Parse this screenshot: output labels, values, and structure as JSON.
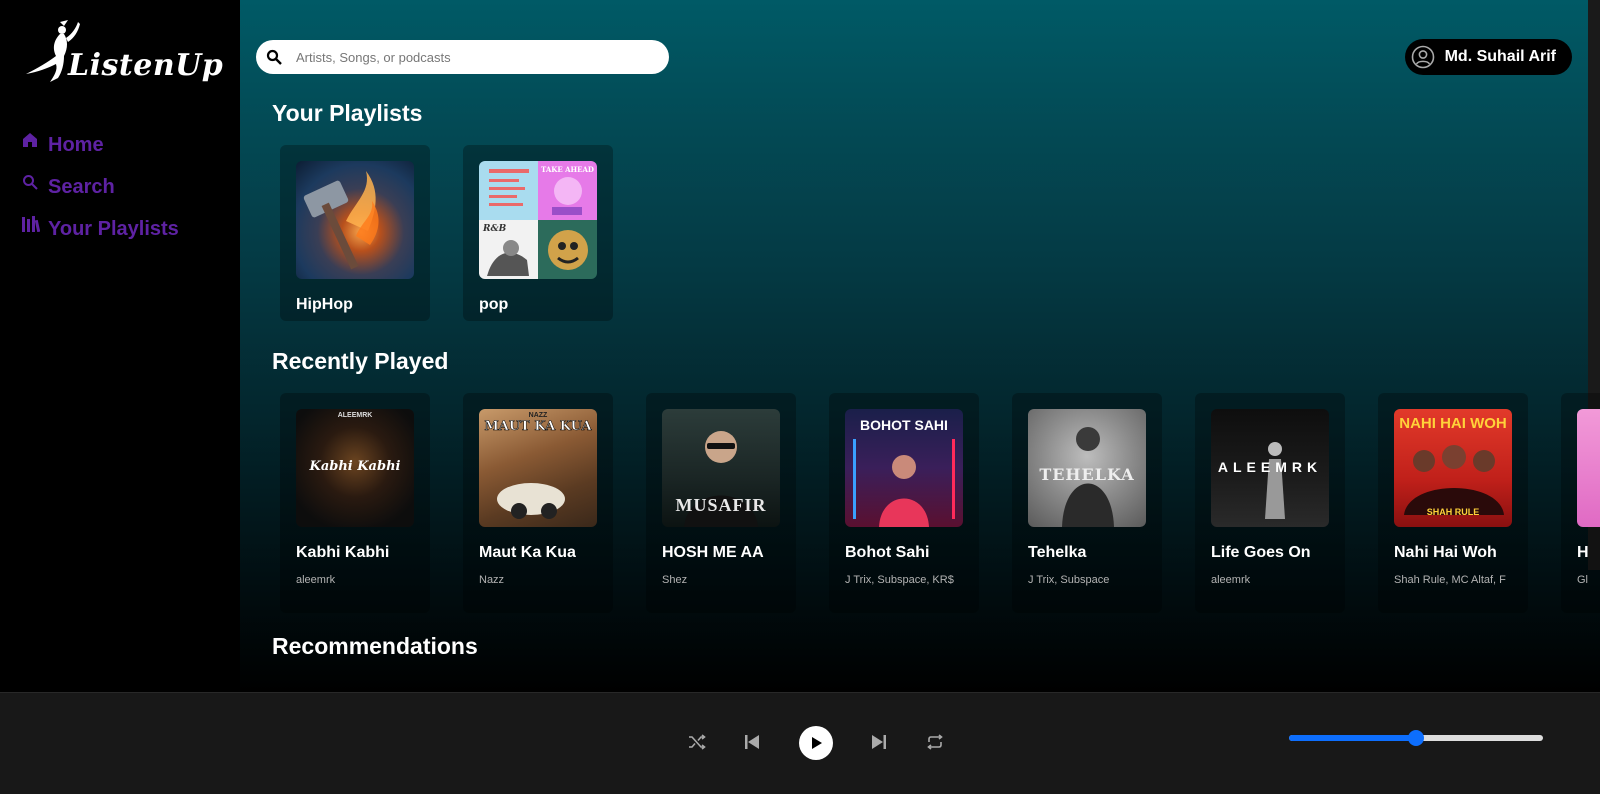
{
  "app": {
    "name": "ListenUp"
  },
  "sidebar": {
    "items": [
      {
        "label": "Home",
        "icon": "home-icon"
      },
      {
        "label": "Search",
        "icon": "search-icon"
      },
      {
        "label": "Your Playlists",
        "icon": "library-icon"
      }
    ]
  },
  "search": {
    "placeholder": "Artists, Songs, or podcasts"
  },
  "user": {
    "name": "Md. Suhail Arif"
  },
  "sections": {
    "playlists_title": "Your Playlists",
    "recent_title": "Recently Played",
    "recommendations_title": "Recommendations"
  },
  "playlists": [
    {
      "name": "HipHop"
    },
    {
      "name": "pop"
    }
  ],
  "cover_texts": {
    "pop_tl": "TAKE AHEAD",
    "pop_bl": "R&B",
    "kabhi": "Kabhi Kabhi",
    "kabhi_artist": "ALEEMRK",
    "maut": "MAUT KA KUA",
    "maut_artist": "NAZZ",
    "musafir": "MUSAFIR",
    "bohot": "BOHOT SAHI",
    "tehelka": "TEHELKA",
    "aleemrk": "ALEEMRK",
    "nahi": "NAHI HAI WOH",
    "nahi_sub": "SHAH RULE"
  },
  "recently_played": [
    {
      "title": "Kabhi Kabhi",
      "artist": "aleemrk"
    },
    {
      "title": "Maut Ka Kua",
      "artist": "Nazz"
    },
    {
      "title": "HOSH ME AA",
      "artist": "Shez"
    },
    {
      "title": "Bohot Sahi",
      "artist": "J Trix, Subspace, KR$"
    },
    {
      "title": "Tehelka",
      "artist": "J Trix, Subspace"
    },
    {
      "title": "Life Goes On",
      "artist": "aleemrk"
    },
    {
      "title": "Nahi Hai Woh",
      "artist": "Shah Rule, MC Altaf, F"
    },
    {
      "title": "H",
      "artist": "Gl"
    }
  ],
  "player": {
    "volume": 0.5,
    "controls": [
      "shuffle-icon",
      "previous-icon",
      "play-icon",
      "next-icon",
      "repeat-icon"
    ]
  },
  "colors": {
    "nav_purple": "#5e22a3",
    "accent_blue": "#0d6efd",
    "player_bg": "#181818"
  }
}
